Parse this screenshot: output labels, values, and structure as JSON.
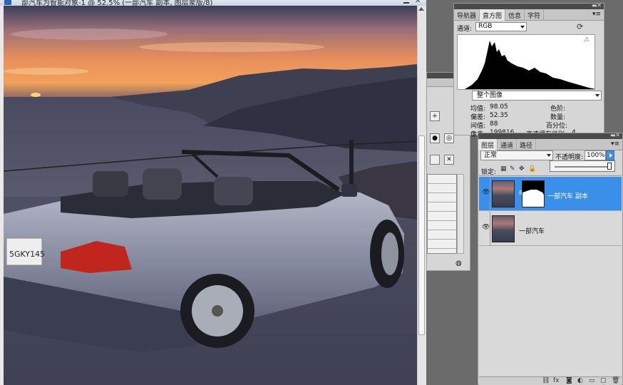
{
  "document": {
    "title": "部汽车为智能对象-1 @ 52.5% (一部汽车 副本, 图层蒙版/8)",
    "plate_text": "5GKY145"
  },
  "histogram_panel": {
    "tabs": [
      {
        "label": "导航器",
        "active": false
      },
      {
        "label": "直方图",
        "active": true
      },
      {
        "label": "信息",
        "active": false
      },
      {
        "label": "字符",
        "active": false
      }
    ],
    "channel_label": "通道:",
    "channel_value": "RGB",
    "source_value": "整个图像",
    "stats_left": [
      {
        "label": "均值:",
        "value": "98.05"
      },
      {
        "label": "偏差:",
        "value": "52.35"
      },
      {
        "label": "间值:",
        "value": "88"
      },
      {
        "label": "像素:",
        "value": "199816"
      }
    ],
    "stats_right": [
      {
        "label": "色阶:",
        "value": ""
      },
      {
        "label": "数量:",
        "value": ""
      },
      {
        "label": "百分位:",
        "value": ""
      },
      {
        "label": "高速缓存级别:",
        "value": "4"
      }
    ]
  },
  "layers_panel": {
    "tabs": [
      {
        "label": "图层",
        "active": true
      },
      {
        "label": "通道",
        "active": false
      },
      {
        "label": "路径",
        "active": false
      }
    ],
    "blend_mode": "正常",
    "opacity_label": "不透明度:",
    "opacity_value": "100%",
    "opacity_fraction": 1.0,
    "lock_label": "锁定:",
    "layers": [
      {
        "name": "一部汽车 副本",
        "selected": true,
        "has_mask": true
      },
      {
        "name": "一部汽车",
        "selected": false,
        "has_mask": false
      }
    ]
  },
  "colors": {
    "selection_blue": "#3a8fe8",
    "panel_gray": "#d6d6d6"
  },
  "icons": [
    "ps-icon",
    "minimize-icon",
    "close-icon",
    "refresh-icon",
    "warning-icon",
    "eye-icon",
    "link-icon",
    "lock-icon",
    "menu-icon"
  ]
}
